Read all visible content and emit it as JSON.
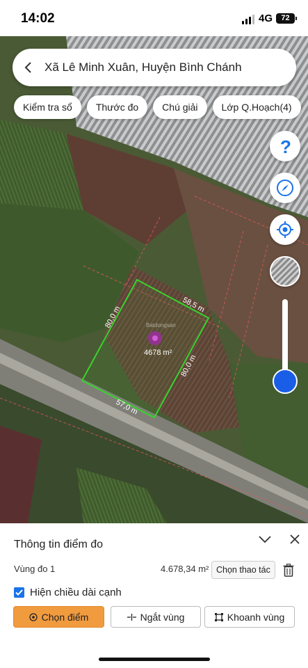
{
  "status_bar": {
    "time": "14:02",
    "network": "4G",
    "battery": "72"
  },
  "header": {
    "location_title": "Xã Lê Minh Xuân, Huyện Bình Chánh"
  },
  "chips": [
    "Kiểm tra sổ",
    "Thước đo",
    "Chú giải",
    "Lớp Q.Hoạch(4)"
  ],
  "map": {
    "edge_labels": {
      "top": "58,5 m",
      "left": "80,0 m",
      "right": "80,0 m",
      "bottom": "57,0 m"
    },
    "area_label": "4678 m²",
    "watermark": "Batdongsan",
    "zoom_level": 0.05,
    "polygon_color": "#39d22d",
    "slider_color": "#1a5ee8"
  },
  "panel": {
    "title": "Thông tin điểm đo",
    "region_label": "Vùng đo 1",
    "area_value": "4.678,34 m²",
    "action_button": "Chọn thao tác",
    "show_edge_length_label": "Hiện chiều dài cạnh",
    "show_edge_length_checked": true,
    "buttons": {
      "select_point": "Chọn điểm",
      "split_region": "Ngắt vùng",
      "area_region": "Khoanh vùng"
    },
    "accent_color": "#f19b3f"
  }
}
